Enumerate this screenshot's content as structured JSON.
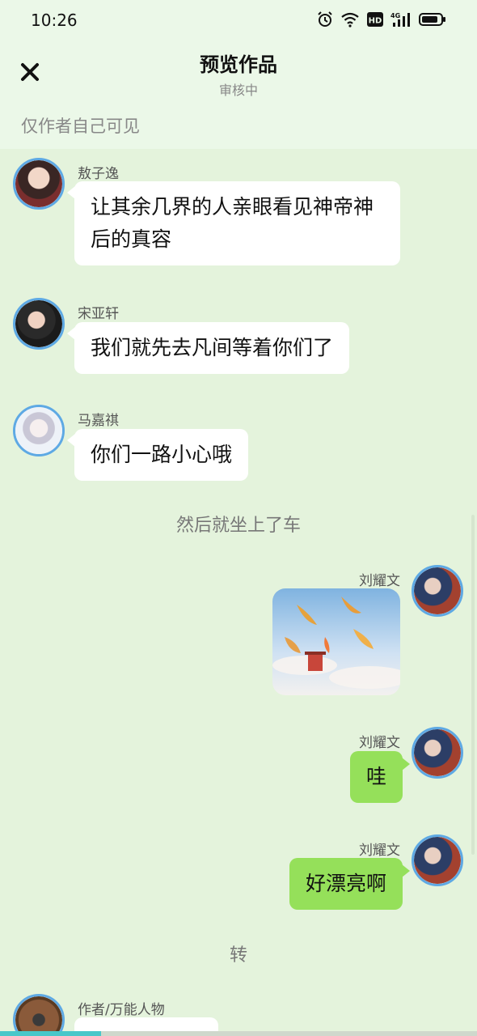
{
  "status_bar": {
    "time": "10:26"
  },
  "header": {
    "title": "预览作品",
    "subtitle": "审核中",
    "visibility_note": "仅作者自己可见"
  },
  "messages": [
    {
      "sender": "敖子逸",
      "side": "left",
      "text": "让其余几界的人亲眼看见神帝神后的真容"
    },
    {
      "sender": "宋亚轩",
      "side": "left",
      "text": "我们就先去凡间等着你们了"
    },
    {
      "sender": "马嘉祺",
      "side": "left",
      "text": "你们一路小心哦"
    },
    {
      "narration": "然后就坐上了车"
    },
    {
      "sender": "刘耀文",
      "side": "right",
      "type": "image",
      "description": "fantasy sky with golden fish"
    },
    {
      "sender": "刘耀文",
      "side": "right",
      "text": "哇"
    },
    {
      "sender": "刘耀文",
      "side": "right",
      "text": "好漂亮啊"
    },
    {
      "narration": "转"
    },
    {
      "sender": "作者/万能人物",
      "side": "left",
      "text": ""
    }
  ],
  "colors": {
    "background": "#e4f3dc",
    "header_bg": "#ebf8e8",
    "bubble_left": "#ffffff",
    "bubble_right": "#95e05a",
    "avatar_ring": "#5ea9e4"
  },
  "icons": [
    "close-icon",
    "alarm-icon",
    "wifi-icon",
    "hd-icon",
    "signal-4g-icon",
    "battery-icon"
  ]
}
